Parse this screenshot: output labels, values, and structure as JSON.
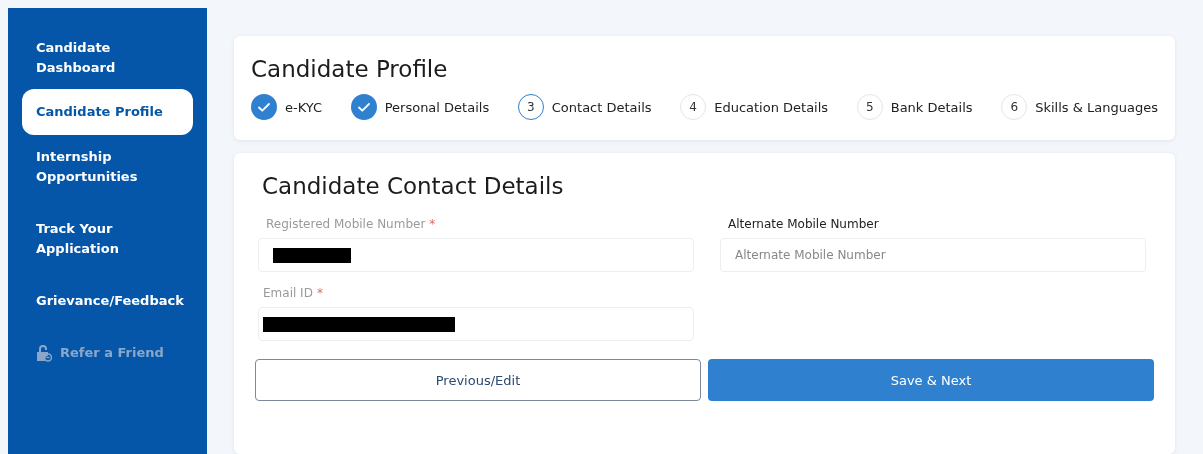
{
  "sidebar": {
    "items": [
      {
        "label": "Candidate Dashboard",
        "selected": false,
        "disabled": false
      },
      {
        "label": "Candidate Profile",
        "selected": true,
        "disabled": false
      },
      {
        "label": "Internship Opportunities",
        "selected": false,
        "disabled": false
      },
      {
        "label": "Track Your Application",
        "selected": false,
        "disabled": false
      },
      {
        "label": "Grievance/Feedback",
        "selected": false,
        "disabled": false
      },
      {
        "label": "Refer a Friend",
        "selected": false,
        "disabled": true
      }
    ]
  },
  "profile": {
    "title": "Candidate Profile",
    "steps": [
      {
        "label": "e-KYC",
        "done": true
      },
      {
        "label": "Personal Details",
        "done": true
      },
      {
        "number": "3",
        "label": "Contact Details",
        "done": false,
        "current": true
      },
      {
        "number": "4",
        "label": "Education Details",
        "done": false,
        "current": false
      },
      {
        "number": "5",
        "label": "Bank Details",
        "done": false,
        "current": false
      },
      {
        "number": "6",
        "label": "Skills & Languages",
        "done": false,
        "current": false
      }
    ]
  },
  "form": {
    "title": "Candidate Contact Details",
    "fields": [
      {
        "label": "Registered Mobile Number",
        "required_mark": "*",
        "disabled": true,
        "redacted": true
      },
      {
        "label": "Alternate Mobile Number",
        "disabled": false,
        "placeholder": "Alternate Mobile Number"
      },
      {
        "label": "Email ID",
        "required_mark": "*",
        "disabled": true,
        "redacted": true
      }
    ],
    "buttons": [
      {
        "label": "Previous/Edit",
        "kind": "secondary"
      },
      {
        "label": "Save & Next",
        "kind": "primary"
      }
    ]
  }
}
